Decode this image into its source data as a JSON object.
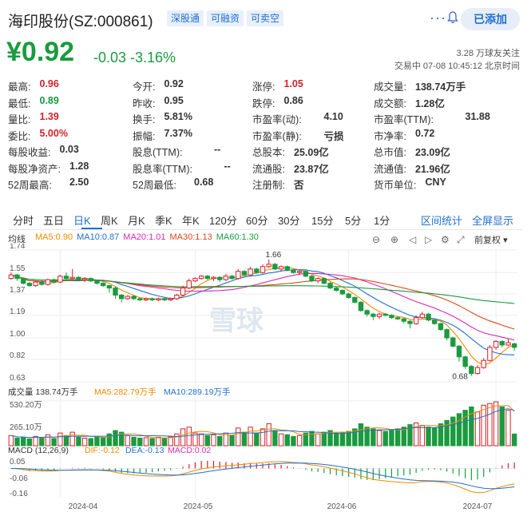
{
  "header": {
    "title": "海印股份(SZ:000861)",
    "tags": [
      "深股通",
      "可融资",
      "可卖空"
    ],
    "add_button": "已添加"
  },
  "quote": {
    "price": "¥0.92",
    "change": "-0.03 -3.16%",
    "followers": "3.28 万球友关注",
    "trade_status": "交易中 07-08 10:45:12 北京时间"
  },
  "stats": [
    [
      "最高:",
      "0.96",
      "今开:",
      "0.92",
      "涨停:",
      "1.05",
      "成交量:",
      "138.74万手"
    ],
    [
      "最低:",
      "0.89",
      "昨收:",
      "0.95",
      "跌停:",
      "0.86",
      "成交额:",
      "1.28亿"
    ],
    [
      "量比:",
      "1.39",
      "换手:",
      "5.81%",
      "市盈率(动):",
      "4.10",
      "市盈率(TTM):",
      "31.88"
    ],
    [
      "委比:",
      "5.00%",
      "振幅:",
      "7.37%",
      "市盈率(静):",
      "亏损",
      "市净率:",
      "0.72"
    ],
    [
      "每股收益:",
      "0.03",
      "股息(TTM):",
      "--",
      "总股本:",
      "25.09亿",
      "总市值:",
      "23.09亿"
    ],
    [
      "每股净资产:",
      "1.28",
      "股息率(TTM):",
      "--",
      "流通股:",
      "23.87亿",
      "流通值:",
      "21.96亿"
    ],
    [
      "52周最高:",
      "2.50",
      "52周最低:",
      "0.68",
      "注册制:",
      "否",
      "货币单位:",
      "CNY"
    ]
  ],
  "tabs": [
    "分时",
    "五日",
    "日K",
    "周K",
    "月K",
    "季K",
    "年K",
    "120分",
    "60分",
    "30分",
    "15分",
    "5分",
    "1分"
  ],
  "tab_links": [
    "区间统计",
    "全屏显示"
  ],
  "chart_tools": {
    "label": "均线",
    "adjust": "前复权"
  },
  "colors": {
    "up": "#d3222a",
    "down": "#1a9b3f",
    "accent": "#1f6fd1",
    "ma5": "#f08a00",
    "ma10": "#1f6fd1",
    "ma20": "#d62bb7",
    "ma30": "#e0461a",
    "ma60": "#1a9b3f"
  },
  "chart_data": [
    {
      "type": "candlestick",
      "legend": [
        "MA5:0.90",
        "MA10:0.87",
        "MA20:1.01",
        "MA30:1.13",
        "MA60:1.30"
      ],
      "y_ticks": [
        "1.74",
        "1.55",
        "1.37",
        "1.19",
        "1.00",
        "0.82",
        "0.63"
      ],
      "ylim": [
        0.63,
        1.74
      ],
      "x_ticks": [
        "2024-04",
        "2024-05",
        "2024-06",
        "2024-07"
      ],
      "annotations": [
        "1.66",
        "0.68"
      ],
      "watermark": "雪球",
      "candles": [
        [
          1.5,
          1.53,
          1.55,
          1.49
        ],
        [
          1.53,
          1.5,
          1.54,
          1.48
        ],
        [
          1.5,
          1.46,
          1.51,
          1.45
        ],
        [
          1.46,
          1.44,
          1.47,
          1.43
        ],
        [
          1.44,
          1.47,
          1.48,
          1.43
        ],
        [
          1.47,
          1.45,
          1.49,
          1.44
        ],
        [
          1.45,
          1.49,
          1.5,
          1.44
        ],
        [
          1.49,
          1.47,
          1.5,
          1.46
        ],
        [
          1.47,
          1.52,
          1.53,
          1.46
        ],
        [
          1.52,
          1.5,
          1.55,
          1.49
        ],
        [
          1.5,
          1.51,
          1.58,
          1.49
        ],
        [
          1.51,
          1.49,
          1.52,
          1.48
        ],
        [
          1.49,
          1.5,
          1.51,
          1.47
        ],
        [
          1.5,
          1.48,
          1.51,
          1.47
        ],
        [
          1.48,
          1.46,
          1.49,
          1.45
        ],
        [
          1.46,
          1.44,
          1.47,
          1.43
        ],
        [
          1.44,
          1.42,
          1.45,
          1.38
        ],
        [
          1.42,
          1.36,
          1.43,
          1.33
        ],
        [
          1.36,
          1.33,
          1.37,
          1.3
        ],
        [
          1.33,
          1.35,
          1.36,
          1.32
        ],
        [
          1.35,
          1.33,
          1.36,
          1.32
        ],
        [
          1.33,
          1.32,
          1.34,
          1.31
        ],
        [
          1.32,
          1.33,
          1.34,
          1.31
        ],
        [
          1.33,
          1.32,
          1.34,
          1.31
        ],
        [
          1.32,
          1.33,
          1.34,
          1.31
        ],
        [
          1.33,
          1.32,
          1.34,
          1.31
        ],
        [
          1.32,
          1.33,
          1.34,
          1.31
        ],
        [
          1.33,
          1.36,
          1.37,
          1.32
        ],
        [
          1.36,
          1.42,
          1.44,
          1.35
        ],
        [
          1.42,
          1.48,
          1.5,
          1.41
        ],
        [
          1.48,
          1.5,
          1.51,
          1.47
        ],
        [
          1.5,
          1.52,
          1.53,
          1.49
        ],
        [
          1.52,
          1.5,
          1.53,
          1.49
        ],
        [
          1.5,
          1.51,
          1.52,
          1.48
        ],
        [
          1.51,
          1.49,
          1.52,
          1.47
        ],
        [
          1.49,
          1.52,
          1.54,
          1.48
        ],
        [
          1.52,
          1.5,
          1.53,
          1.49
        ],
        [
          1.5,
          1.56,
          1.58,
          1.49
        ],
        [
          1.56,
          1.53,
          1.57,
          1.52
        ],
        [
          1.53,
          1.58,
          1.6,
          1.52
        ],
        [
          1.58,
          1.55,
          1.59,
          1.54
        ],
        [
          1.55,
          1.6,
          1.62,
          1.54
        ],
        [
          1.6,
          1.62,
          1.66,
          1.59
        ],
        [
          1.62,
          1.58,
          1.63,
          1.57
        ],
        [
          1.58,
          1.6,
          1.61,
          1.56
        ],
        [
          1.6,
          1.57,
          1.61,
          1.56
        ],
        [
          1.57,
          1.55,
          1.58,
          1.54
        ],
        [
          1.55,
          1.56,
          1.57,
          1.53
        ],
        [
          1.56,
          1.52,
          1.57,
          1.51
        ],
        [
          1.52,
          1.48,
          1.53,
          1.47
        ],
        [
          1.48,
          1.5,
          1.51,
          1.46
        ],
        [
          1.5,
          1.46,
          1.51,
          1.45
        ],
        [
          1.46,
          1.42,
          1.47,
          1.41
        ],
        [
          1.42,
          1.4,
          1.43,
          1.39
        ],
        [
          1.4,
          1.37,
          1.41,
          1.36
        ],
        [
          1.37,
          1.34,
          1.38,
          1.33
        ],
        [
          1.34,
          1.3,
          1.35,
          1.29
        ],
        [
          1.3,
          1.23,
          1.31,
          1.22
        ],
        [
          1.23,
          1.2,
          1.24,
          1.18
        ],
        [
          1.2,
          1.18,
          1.21,
          1.15
        ],
        [
          1.18,
          1.2,
          1.21,
          1.16
        ],
        [
          1.2,
          1.19,
          1.21,
          1.18
        ],
        [
          1.19,
          1.17,
          1.2,
          1.16
        ],
        [
          1.17,
          1.16,
          1.18,
          1.15
        ],
        [
          1.16,
          1.14,
          1.17,
          1.12
        ],
        [
          1.14,
          1.12,
          1.15,
          1.08
        ],
        [
          1.12,
          1.17,
          1.19,
          1.11
        ],
        [
          1.17,
          1.2,
          1.22,
          1.16
        ],
        [
          1.2,
          1.15,
          1.21,
          1.14
        ],
        [
          1.15,
          1.12,
          1.16,
          1.11
        ],
        [
          1.12,
          1.07,
          1.13,
          1.06
        ],
        [
          1.07,
          1.0,
          1.08,
          0.98
        ],
        [
          1.0,
          0.93,
          1.01,
          0.92
        ],
        [
          0.93,
          0.84,
          0.94,
          0.8
        ],
        [
          0.84,
          0.76,
          0.85,
          0.74
        ],
        [
          0.76,
          0.7,
          0.77,
          0.68
        ],
        [
          0.7,
          0.75,
          0.77,
          0.69
        ],
        [
          0.75,
          0.81,
          0.83,
          0.74
        ],
        [
          0.81,
          0.92,
          0.94,
          0.8
        ],
        [
          0.92,
          0.97,
          0.98,
          0.9
        ],
        [
          0.97,
          0.94,
          0.98,
          0.92
        ],
        [
          0.94,
          0.96,
          0.99,
          0.93
        ],
        [
          0.95,
          0.92,
          0.96,
          0.89
        ]
      ]
    },
    {
      "type": "bar",
      "legend": [
        "成交量 138.74万手",
        "MA5:282.79万手",
        "MA10:289.19万手"
      ],
      "y_ticks": [
        "530.20万",
        "265.10万"
      ],
      "ylim": [
        0,
        530.2
      ],
      "values": [
        120,
        90,
        100,
        80,
        110,
        95,
        130,
        85,
        150,
        120,
        160,
        100,
        90,
        85,
        110,
        100,
        140,
        180,
        160,
        120,
        100,
        90,
        95,
        85,
        100,
        90,
        105,
        140,
        200,
        220,
        150,
        140,
        120,
        130,
        110,
        150,
        120,
        210,
        160,
        220,
        150,
        200,
        260,
        180,
        140,
        130,
        110,
        120,
        150,
        170,
        140,
        160,
        180,
        150,
        160,
        170,
        200,
        260,
        220,
        200,
        180,
        170,
        190,
        200,
        220,
        250,
        270,
        240,
        220,
        210,
        260,
        300,
        340,
        380,
        420,
        460,
        400,
        480,
        500,
        520,
        460,
        420,
        138.74
      ]
    },
    {
      "type": "line",
      "legend": [
        "MACD (12,26,9)",
        "DIF:-0.12",
        "DEA:-0.13",
        "MACD:0.02"
      ],
      "y_ticks": [
        "0.05",
        "-0.06",
        "-0.16"
      ],
      "ylim": [
        -0.19,
        0.07
      ]
    }
  ]
}
